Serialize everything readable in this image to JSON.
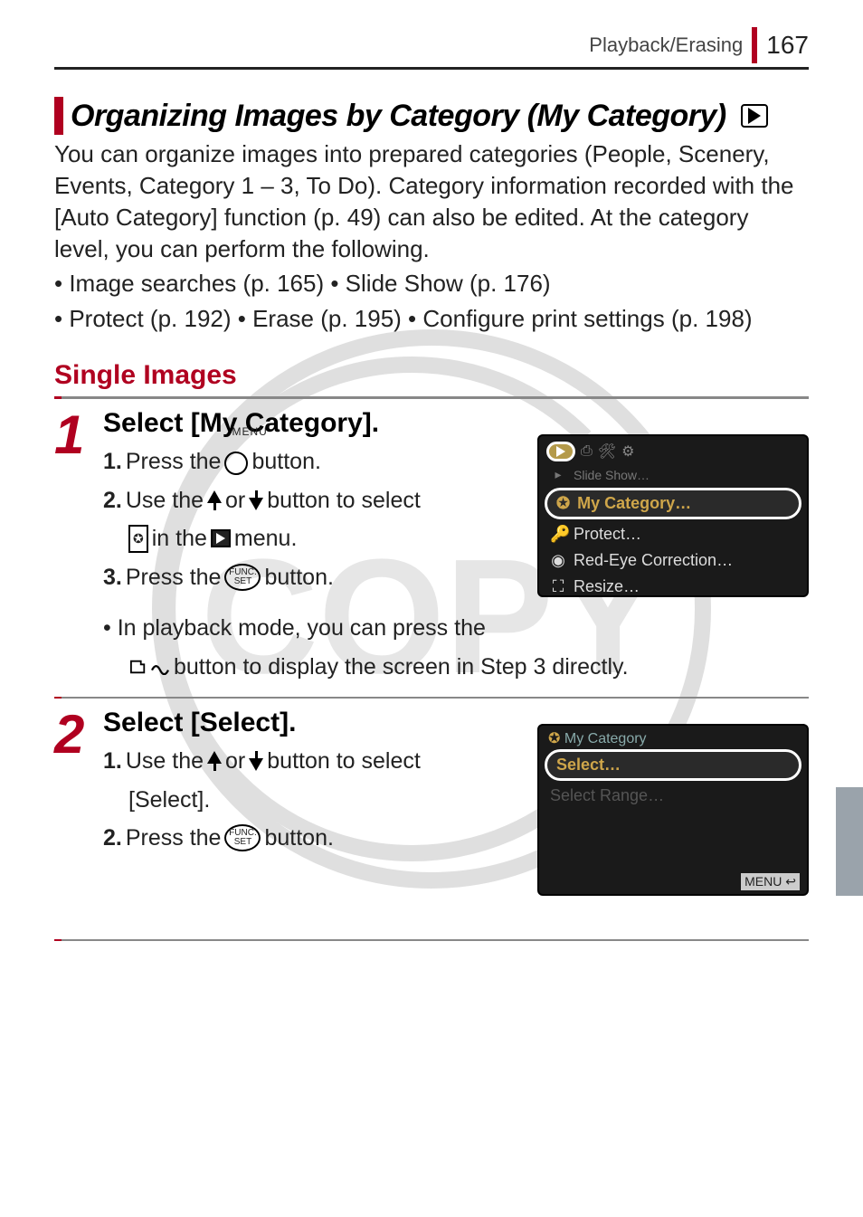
{
  "header": {
    "section": "Playback/Erasing",
    "page": "167"
  },
  "title": "Organizing Images by Category (My Category)",
  "intro": "You can organize images into prepared categories (People, Scenery, Events, Category 1 – 3, To Do). Category information recorded with the [Auto Category] function (p. 49) can also be edited. At the category level, you can perform the following.",
  "bullets_line1": "• Image searches (p. 165)    • Slide Show (p. 176)",
  "bullets_line2": "• Protect (p. 192)   • Erase (p. 195)   • Configure print settings (p. 198)",
  "section_title": "Single Images",
  "step1": {
    "num": "1",
    "heading": "Select [My Category].",
    "line1a": "1.",
    "line1b": "Press the",
    "line1c": "button.",
    "menu_label": "MENU",
    "line2a": "2.",
    "line2b": "Use the",
    "line2c": "or",
    "line2d": "button to select",
    "line2e": "in the",
    "line2f": "menu.",
    "line3a": "3.",
    "line3b": "Press the",
    "line3c": "button.",
    "note_a": "• In playback mode, you can press the",
    "note_b": "button to display the screen in Step 3 directly."
  },
  "step2": {
    "num": "2",
    "heading": "Select [Select].",
    "line1a": "1.",
    "line1b": "Use the",
    "line1c": "or",
    "line1d": "button to select",
    "line1e": "[Select].",
    "line2a": "2.",
    "line2b": "Press the",
    "line2c": "button."
  },
  "func_label_top": "FUNC.",
  "func_label_bot": "SET",
  "screenshot1": {
    "slide": "Slide Show…",
    "selected": "My Category…",
    "protect": "Protect…",
    "redeye": "Red-Eye Correction…",
    "resize": "Resize…"
  },
  "screenshot2": {
    "title": "My Category",
    "selected": "Select…",
    "range": "Select Range…",
    "menu": "MENU"
  }
}
